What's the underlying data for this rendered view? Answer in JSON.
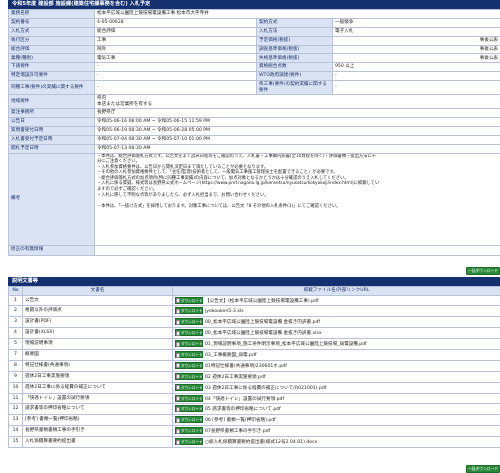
{
  "section1": {
    "header": "令和5年度 建設部 施設課(建築住宅課事務を含む) 入札予定"
  },
  "info": {
    "project_name_label": "業務名称",
    "project_name": "松本平広域公園陸上競技場電設備工事 松本市大字寺井",
    "contract_no_label": "契約番号",
    "contract_no": "4-05-00628",
    "contract_method_label": "契約方式",
    "contract_method": "一般競争",
    "bid_method_label": "入札方式",
    "bid_method": "総合評価",
    "bid_form_label": "入札方法",
    "bid_form": "電子入札",
    "work_type_label": "執行区分",
    "work_type": "工事",
    "planned_price_label": "予定価格(税抜)",
    "planned_price": "事後公表",
    "eval_label": "総合評価",
    "eval": "除外",
    "survey_base_label": "調査基準価格(税抜)",
    "survey_base": "事後公表",
    "category_label": "業種(種別)",
    "category": "電気工事",
    "min_price_label": "失格基準価格(税抜)",
    "min_price": "事後公表",
    "sub_label": "下請要件",
    "sub_value": "-",
    "score_label": "資格総合点数",
    "score": "950 以上",
    "special_label": "特定増設許可要件",
    "special_value": "-",
    "wto_label": "WTO政府調達(要件)",
    "wto": "-",
    "jv_label": "同種工事(要件)の実績に関する要件",
    "jv_value": "-",
    "record_label": "県工事(要件)の契約実績に関する要件",
    "record_value": "-",
    "region_label": "地域要件",
    "region": "県内\n本店または営業所を有する",
    "office_label": "発注事務所",
    "office": "長野県庁",
    "notice_label": "公告日",
    "notice": "令和05-06-16 08:00 AM ~ 令和05-06-15 11:59 PM",
    "question_label": "質問書受付日時",
    "question": "令和05-06-19 08:30 AM ~ 令和05-06-28 05:00 PM",
    "bidding_label": "入札書受付予定日時",
    "bidding": "令和05-07-04 08:30 AM ~ 令和05-07-10 01:00 PM",
    "opening_label": "開札予定日時",
    "opening": "令和05-07-13 08:30 AM",
    "notes_label": "備考",
    "notes": "・本件は、総合評価落札方式です。公告文をよく読み日程等をご確認のうえ、入札書・工事費内訳書(全10頁程を除く)・評価書類・提出方法に十分にご注意ください。\n・入札参加資格要件は、公告日から開札決定日まで満たしていることが必要となります。\n・その他の入札参加資格要件として、「主任(監理)技術者として、一般電気工事施工管理技士を配置できること」が必要です。\n・総合評価落札方式の加点項目(特に同種工事実績)の内容について、加点対象となるかどうかは十分確認のうえ入札してください。\n・入札に係る質疑、様式等は長野県公式ホームページ(https://www.pref.nagano.lg.jp/kensetsu/nyusatsu/kokyokoji/index.html)に掲載していますので必ずご確認ください。\n・入札に際して不明な点等がありましたら、必ず入札担当まで、お問い合わせください。\n\n・本件は、「一抜け方式」を採用しております。対象工事については、公告文「8 その他の入札条件(3)」にてご確認ください。",
    "revision_label": "修正の有無情報",
    "revision": ""
  },
  "button_bulk": "一括ダウンロード",
  "section2": {
    "header": "説明文書等"
  },
  "files": {
    "col_no": "No",
    "col_name": "文書名",
    "col_file": "掲載ファイル名/外部リンクURL",
    "download_label": "ダウンロード",
    "rows": [
      {
        "no": "1",
        "name": "公告文",
        "file": "【公告文】(松本平広域公園陸上競技場電設備工事).pdf"
      },
      {
        "no": "2",
        "name": "格闘以外の評価点",
        "file": "jyokouken5-3.xls"
      },
      {
        "no": "3",
        "name": "設計書(PDF)",
        "file": "00_松本平広域公園陸上競技場電設備 金抜き内訳書.pdf"
      },
      {
        "no": "4",
        "name": "設計書(XLSX)",
        "file": "00_松本平広域公園陸上競技場電設備 金抜き内訳書.xlsx"
      },
      {
        "no": "5",
        "name": "現場説明事項",
        "file": "01_現場説明事項_施工条件明示事項_松本平広域公園陸上競技場_弱電設備.pdf"
      },
      {
        "no": "7",
        "name": "概要図",
        "file": "03_工事概要図_弱電.pdf"
      },
      {
        "no": "8",
        "name": "特記仕様書(共通事項)",
        "file": "01特記仕様書(共通事項)230601ホ.pdf"
      },
      {
        "no": "9",
        "name": "週休2日工事実施要領",
        "file": "02 週休2日工事実施要領.pdf"
      },
      {
        "no": "10",
        "name": "週休2日工事に係る経費の補正について",
        "file": "03 週休2日工事に係る経費の補正について(R021001).pdf"
      },
      {
        "no": "11",
        "name": "「快適トイレ」設置の試行要領",
        "file": "04「快適トイレ」設置の試行要領.pdf"
      },
      {
        "no": "12",
        "name": "請求書等の押印省略について",
        "file": "05 請求書等の押印省略について.pdf"
      },
      {
        "no": "13",
        "name": "[参考] 書類一覧(押印省略)",
        "file": "06 [参考] 書類一覧(押印省略).pdf"
      },
      {
        "no": "14",
        "name": "長野県書類書類工事の手引き",
        "file": "07長野県書類工事の手引き.pdf"
      },
      {
        "no": "15",
        "name": "入札係積算書要約提出書",
        "file": "○総入札係積算書要約提出書(様式12号2.04.01).docx"
      }
    ]
  }
}
